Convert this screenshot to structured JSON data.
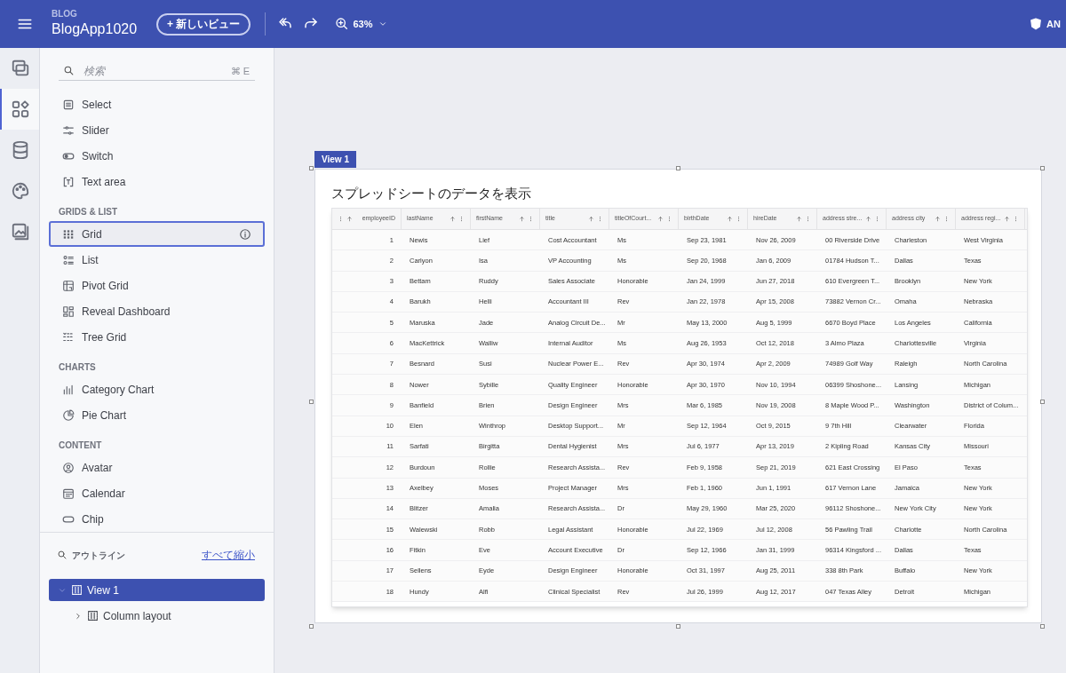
{
  "header": {
    "app_label": "BLOG",
    "app_name": "BlogApp1020",
    "new_view_button": "+ 新しいビュー",
    "zoom": "63%",
    "account_text": "AN"
  },
  "rail": [
    {
      "selected": false
    },
    {
      "selected": true
    },
    {
      "selected": false
    },
    {
      "selected": false
    },
    {
      "selected": false
    }
  ],
  "search": {
    "placeholder": "検索",
    "shortcut": "⌘ E"
  },
  "palette": [
    {
      "items": [
        {
          "label": "Select",
          "selected": false
        },
        {
          "label": "Slider",
          "selected": false
        },
        {
          "label": "Switch",
          "selected": false
        },
        {
          "label": "Text area",
          "selected": false
        }
      ]
    },
    {
      "heading": "GRIDS & LIST",
      "items": [
        {
          "label": "Grid",
          "selected": true
        },
        {
          "label": "List",
          "selected": false
        },
        {
          "label": "Pivot Grid",
          "selected": false
        },
        {
          "label": "Reveal Dashboard",
          "selected": false
        },
        {
          "label": "Tree Grid",
          "selected": false
        }
      ]
    },
    {
      "heading": "CHARTS",
      "items": [
        {
          "label": "Category Chart",
          "selected": false
        },
        {
          "label": "Pie Chart",
          "selected": false
        }
      ]
    },
    {
      "heading": "CONTENT",
      "items": [
        {
          "label": "Avatar",
          "selected": false
        },
        {
          "label": "Calendar",
          "selected": false
        },
        {
          "label": "Chip",
          "selected": false
        }
      ]
    }
  ],
  "outline": {
    "title": "アウトライン",
    "collapse_link": "すべて縮小",
    "tree": [
      {
        "label": "View 1",
        "expanded": true,
        "selected": true,
        "children": [
          {
            "label": "Column layout",
            "expanded": false,
            "selected": false
          }
        ]
      }
    ]
  },
  "canvas": {
    "view_tab": "View 1",
    "heading": "スプレッドシートのデータを表示",
    "columns": [
      "employeeID",
      "lastName",
      "firstName",
      "title",
      "titleOfCourt...",
      "birthDate",
      "hireDate",
      "address stre...",
      "address city",
      "address regi..."
    ],
    "rows": [
      [
        "1",
        "Newis",
        "Lief",
        "Cost Accountant",
        "Ms",
        "Sep 23, 1981",
        "Nov 26, 2009",
        "00 Riverside Drive",
        "Charleston",
        "West Virginia"
      ],
      [
        "2",
        "Carlyon",
        "Isa",
        "VP Accounting",
        "Ms",
        "Sep 20, 1968",
        "Jan 6, 2009",
        "01784 Hudson T...",
        "Dallas",
        "Texas"
      ],
      [
        "3",
        "Bettam",
        "Ruddy",
        "Sales Associate",
        "Honorable",
        "Jan 24, 1999",
        "Jun 27, 2018",
        "610 Evergreen T...",
        "Brooklyn",
        "New York"
      ],
      [
        "4",
        "Barukh",
        "Helli",
        "Accountant III",
        "Rev",
        "Jan 22, 1978",
        "Apr 15, 2008",
        "73882 Vernon Cr...",
        "Omaha",
        "Nebraska"
      ],
      [
        "5",
        "Maruska",
        "Jade",
        "Analog Circuit De...",
        "Mr",
        "May 13, 2000",
        "Aug 5, 1999",
        "6670 Boyd Place",
        "Los Angeles",
        "California"
      ],
      [
        "6",
        "MacKettrick",
        "Walliw",
        "Internal Auditor",
        "Ms",
        "Aug 26, 1953",
        "Oct 12, 2018",
        "3 Almo Plaza",
        "Charlottesville",
        "Virginia"
      ],
      [
        "7",
        "Besnard",
        "Susi",
        "Nuclear Power E...",
        "Rev",
        "Apr 30, 1974",
        "Apr 2, 2009",
        "74989 Golf Way",
        "Raleigh",
        "North Carolina"
      ],
      [
        "8",
        "Nower",
        "Sybille",
        "Quality Engineer",
        "Honorable",
        "Apr 30, 1970",
        "Nov 10, 1994",
        "06399 Shoshone...",
        "Lansing",
        "Michigan"
      ],
      [
        "9",
        "Banfield",
        "Brien",
        "Design Engineer",
        "Mrs",
        "Mar 6, 1985",
        "Nov 19, 2008",
        "8 Maple Wood P...",
        "Washington",
        "District of Colum..."
      ],
      [
        "10",
        "Elen",
        "Winthrop",
        "Desktop Support...",
        "Mr",
        "Sep 12, 1964",
        "Oct 9, 2015",
        "9 7th Hill",
        "Clearwater",
        "Florida"
      ],
      [
        "11",
        "Sarfati",
        "Birgitta",
        "Dental Hygienist",
        "Mrs",
        "Jul 6, 1977",
        "Apr 13, 2019",
        "2 Kipling Road",
        "Kansas City",
        "Missouri"
      ],
      [
        "12",
        "Burdoun",
        "Rollie",
        "Research Assista...",
        "Rev",
        "Feb 9, 1958",
        "Sep 21, 2019",
        "621 East Crossing",
        "El Paso",
        "Texas"
      ],
      [
        "13",
        "Axelbey",
        "Moses",
        "Project Manager",
        "Mrs",
        "Feb 1, 1960",
        "Jun 1, 1991",
        "617 Vernon Lane",
        "Jamaica",
        "New York"
      ],
      [
        "14",
        "Blitzer",
        "Amalia",
        "Research Assista...",
        "Dr",
        "May 29, 1960",
        "Mar 25, 2020",
        "96112 Shoshone...",
        "New York City",
        "New York"
      ],
      [
        "15",
        "Walewski",
        "Robb",
        "Legal Assistant",
        "Honorable",
        "Jul 22, 1969",
        "Jul 12, 2008",
        "56 Pawling Trail",
        "Charlotte",
        "North Carolina"
      ],
      [
        "16",
        "Fitkin",
        "Eve",
        "Account Executive",
        "Dr",
        "Sep 12, 1966",
        "Jan 31, 1999",
        "96314 Kingsford ...",
        "Dallas",
        "Texas"
      ],
      [
        "17",
        "Sellens",
        "Eyde",
        "Design Engineer",
        "Honorable",
        "Oct 31, 1997",
        "Aug 25, 2011",
        "338 8th Park",
        "Buffalo",
        "New York"
      ],
      [
        "18",
        "Hundy",
        "Alfi",
        "Clinical Specialist",
        "Rev",
        "Jul 26, 1999",
        "Aug 12, 2017",
        "047 Texas Alley",
        "Detroit",
        "Michigan"
      ]
    ]
  }
}
